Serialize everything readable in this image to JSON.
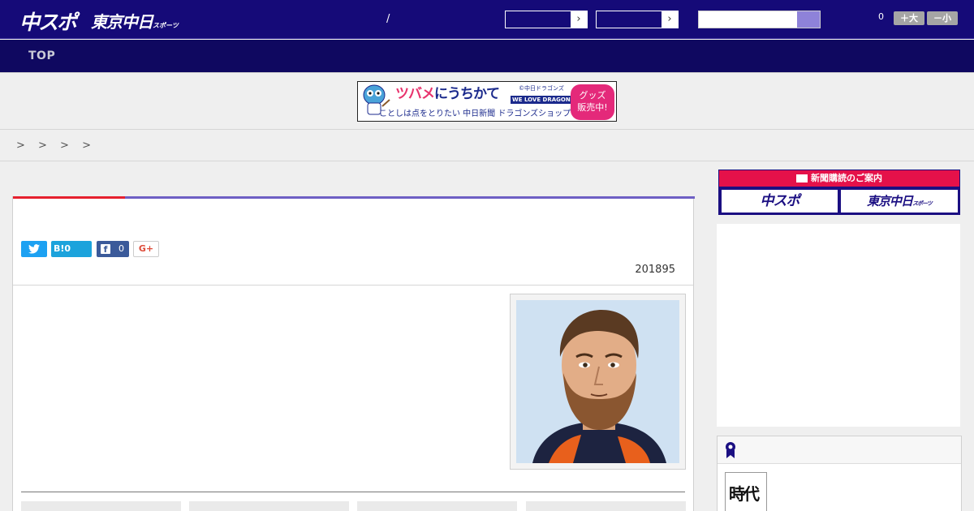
{
  "header": {
    "logo_chuspo": "中スポ",
    "logo_tokyo": "東京中日",
    "logo_tokyo_small": "スポーツ",
    "separator": "/",
    "article_count": "0",
    "font_large": "＋大",
    "font_small": "－小",
    "select_arrow": "›"
  },
  "nav": {
    "top_label": "TOP"
  },
  "banner": {
    "headline_a": "ツバメ",
    "headline_b": "にうちかて",
    "sub": "ことしは点をとりたい 中日新聞 ドラゴンズショップ",
    "copyright": "©中日ドラゴンズ",
    "slogan": "WE LOVE DRAGONS",
    "goods_line1": "グッズ",
    "goods_line2": "販売中!"
  },
  "breadcrumb": "> > > >",
  "article": {
    "share": {
      "hatena": "B!0",
      "facebook_count": "0",
      "gplus": "G+"
    },
    "date": "201895"
  },
  "sidebar": {
    "subscription_heading": "新聞購読のご案内",
    "btn_chuspo": "中スポ",
    "btn_tokyo": "東京中日",
    "btn_tokyo_small": "スポーツ",
    "ranking_thumb_text": "時代"
  },
  "colors": {
    "header_bg": "#150a78",
    "nav_bg": "#0f0860",
    "accent_red": "#e5202e",
    "accent_blue": "#6e5fc4",
    "pink": "#e5114a"
  }
}
